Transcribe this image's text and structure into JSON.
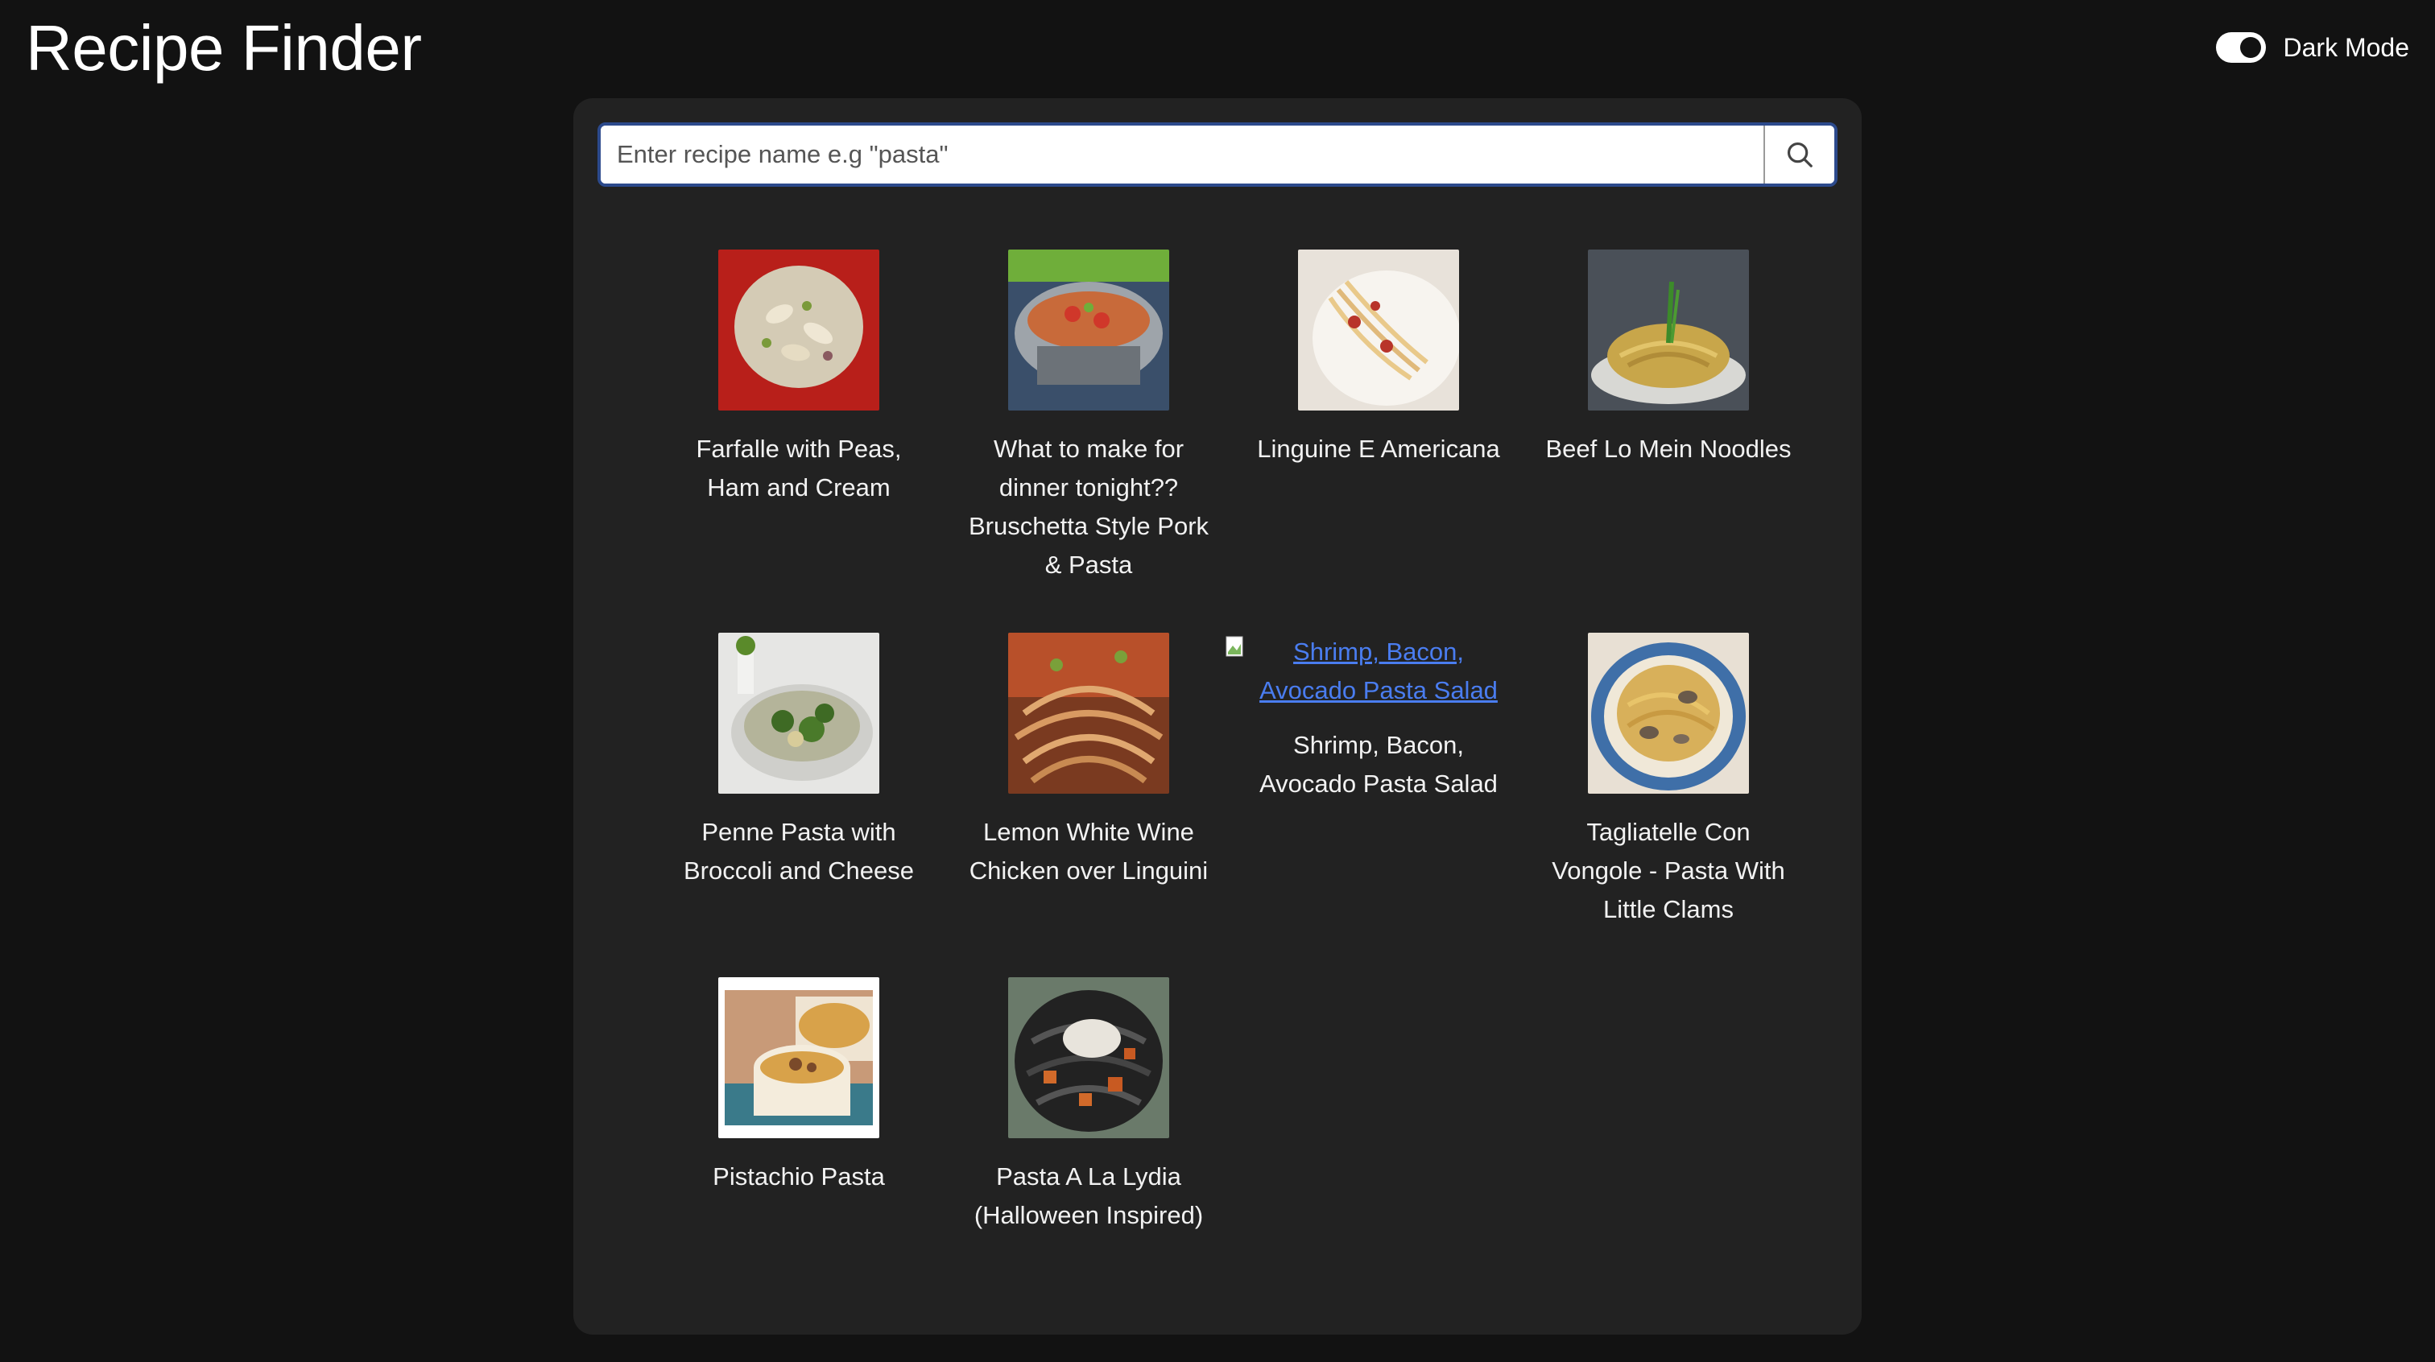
{
  "app": {
    "title": "Recipe Finder"
  },
  "dark_mode": {
    "label": "Dark Mode",
    "enabled": true
  },
  "search": {
    "placeholder": "Enter recipe name e.g \"pasta\"",
    "value": "",
    "button_icon": "search-icon"
  },
  "recipes": [
    {
      "title": "Farfalle with Peas, Ham and Cream",
      "image": "farfalle-photo"
    },
    {
      "title": "What to make for dinner tonight?? Bruschetta Style Pork & Pasta",
      "image": "bruschetta-pork-photo"
    },
    {
      "title": "Linguine E Americana",
      "image": "linguine-photo"
    },
    {
      "title": "Beef Lo Mein Noodles",
      "image": "lo-mein-photo"
    },
    {
      "title": "Penne Pasta with Broccoli and Cheese",
      "image": "penne-broccoli-photo"
    },
    {
      "title": "Lemon White Wine Chicken over Linguini",
      "image": "lemon-chicken-photo"
    },
    {
      "title": "Shrimp, Bacon, Avocado Pasta Salad",
      "image_alt": "Shrimp, Bacon, Avocado Pasta Salad",
      "image": "broken"
    },
    {
      "title": "Tagliatelle Con Vongole - Pasta With Little Clams",
      "image": "tagliatelle-photo"
    },
    {
      "title": "Pistachio Pasta",
      "image": "pistachio-photo"
    },
    {
      "title": "Pasta A La Lydia (Halloween Inspired)",
      "image": "lydia-photo"
    }
  ],
  "colors": {
    "page_bg": "#121212",
    "panel_bg": "#222222",
    "search_border": "#2c4a8c",
    "link": "#4a7df0"
  }
}
